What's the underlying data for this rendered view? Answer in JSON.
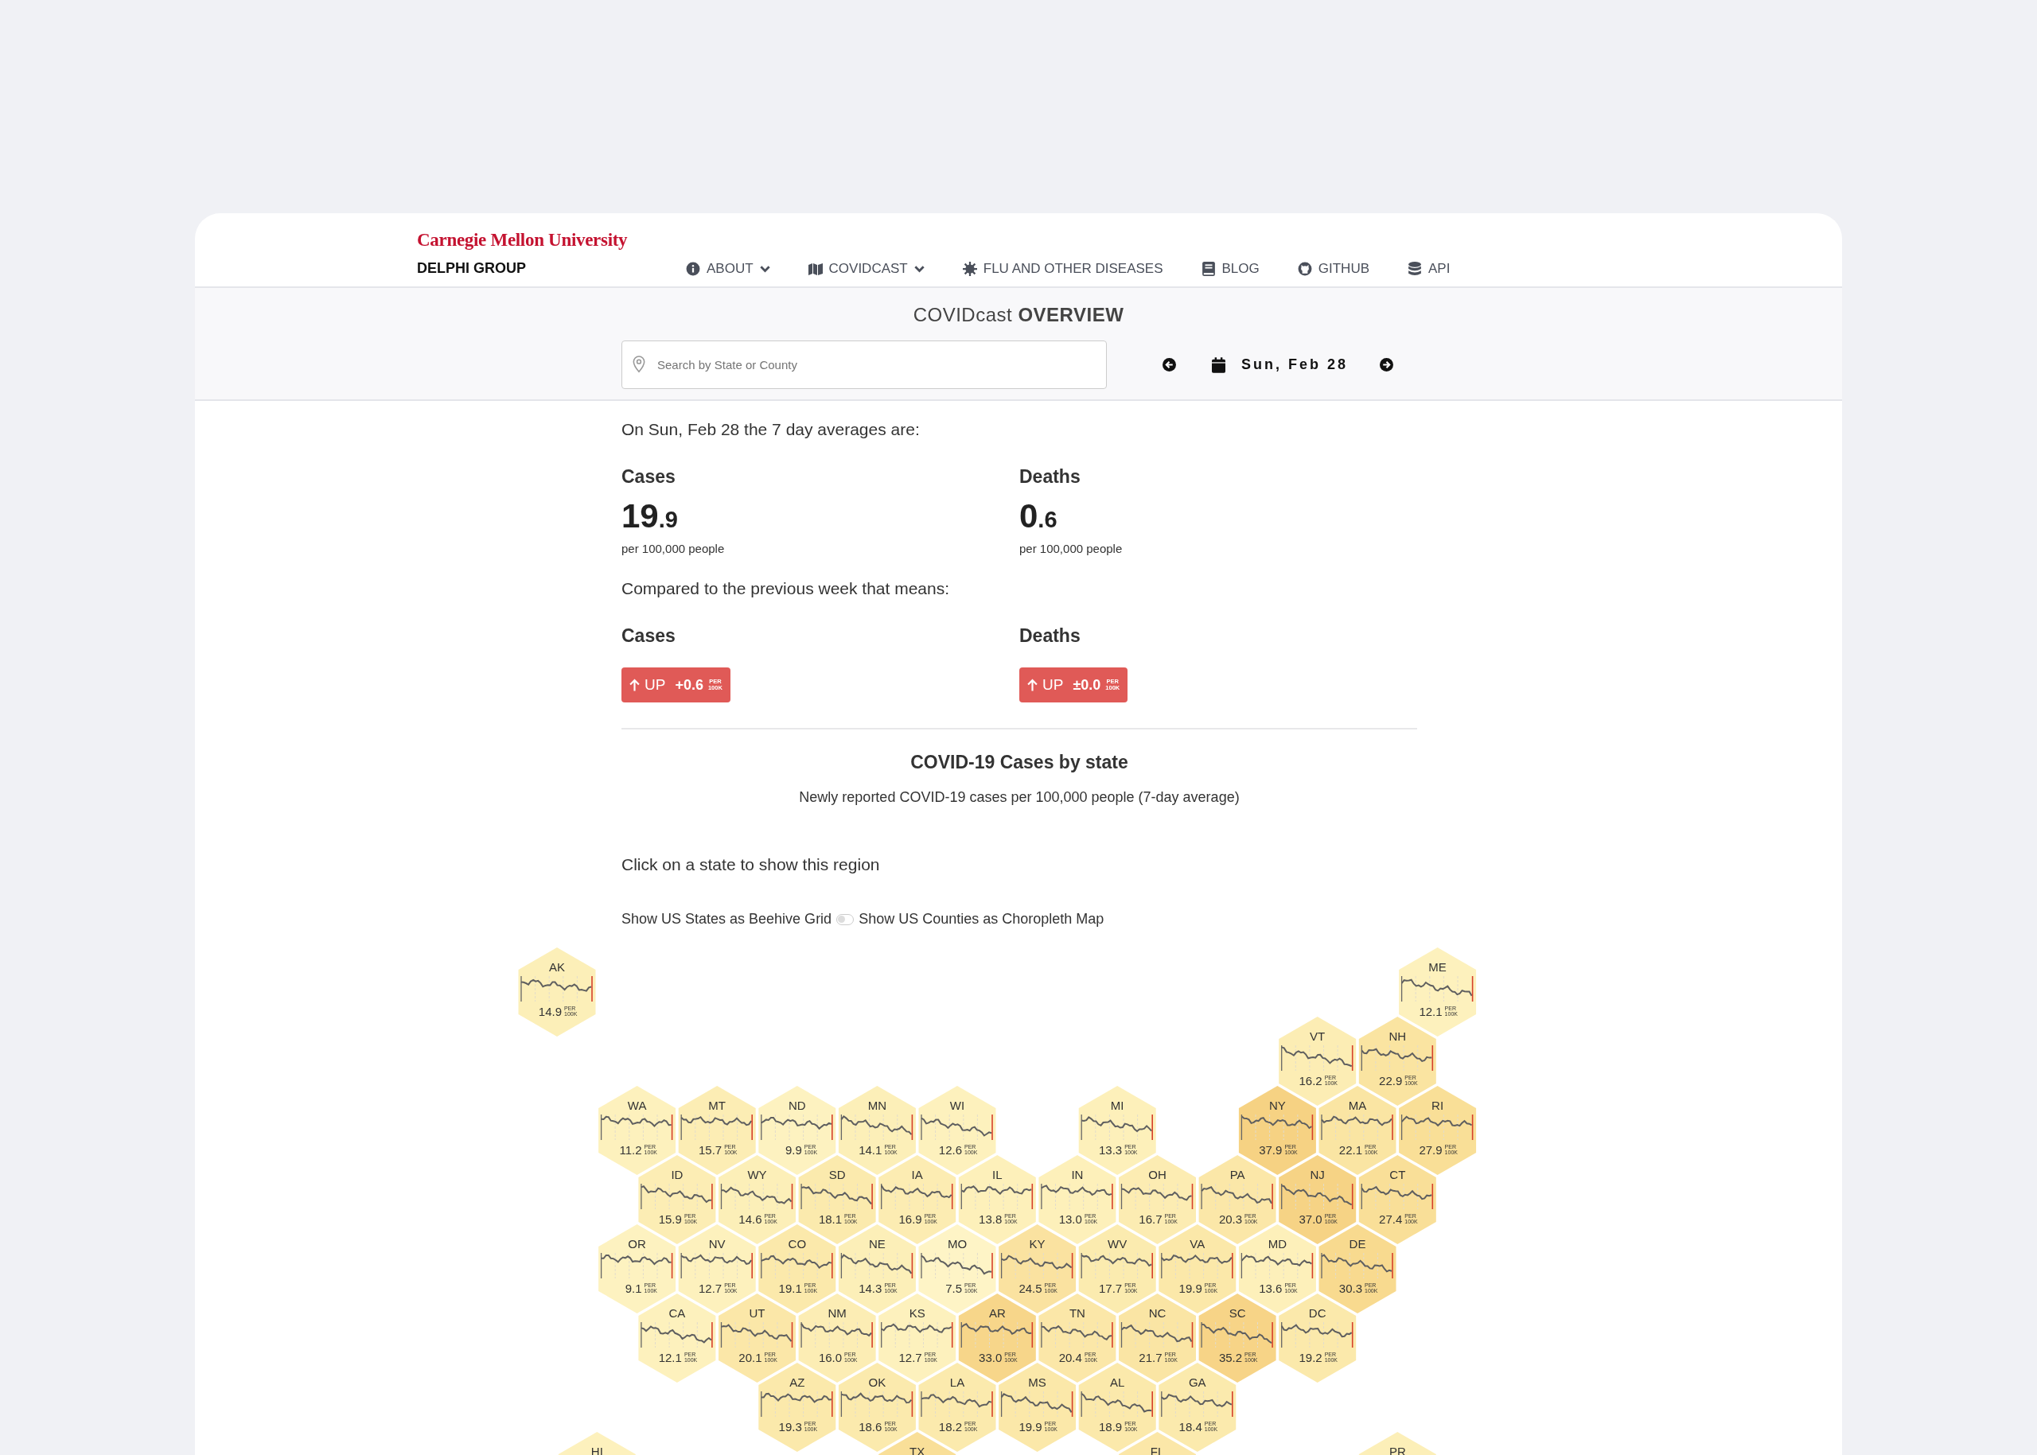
{
  "brand": {
    "university": "Carnegie Mellon University",
    "group": "DELPHI GROUP"
  },
  "nav": [
    {
      "kind": "info",
      "label": "ABOUT",
      "has_menu": true
    },
    {
      "kind": "map",
      "label": "COVIDCAST",
      "has_menu": true
    },
    {
      "kind": "virus",
      "label": "FLU AND OTHER DISEASES",
      "has_menu": false
    },
    {
      "kind": "book",
      "label": "BLOG",
      "has_menu": false
    },
    {
      "kind": "github",
      "label": "GITHUB",
      "has_menu": false
    },
    {
      "kind": "database",
      "label": "API",
      "has_menu": false
    }
  ],
  "page_title": "COVIDcast **OVERVIEW**",
  "search": {
    "placeholder": "Search by State or County"
  },
  "date": "Sun, Feb 28",
  "intro": "On Sun, Feb 28 the 7 day averages are:",
  "averages": [
    {
      "title": "Cases",
      "value_int": "19",
      "value_frac": ".9",
      "unit": "per 100,000 people"
    },
    {
      "title": "Deaths",
      "value_int": "0",
      "value_frac": ".6",
      "unit": "per 100,000 people"
    }
  ],
  "compare_intro": "Compared to the previous week that means:",
  "changes": [
    {
      "title": "Cases",
      "direction": "UP",
      "delta": "+0.6",
      "per": "PER",
      "k": "100K"
    },
    {
      "title": "Deaths",
      "direction": "UP",
      "delta": "±0.0",
      "per": "PER",
      "k": "100K"
    }
  ],
  "map_title": "COVID-19 Cases by state",
  "map_subtitle": "Newly reported COVID-19 cases per 100,000 people (7-day average)",
  "hint": "Click on a state to show this region",
  "toggle": {
    "left": "Show US States as Beehive Grid",
    "right": "Show US Counties as Choropleth Map",
    "on": false
  },
  "hex_rows": [
    [
      {
        "state": "AK",
        "value": "14.9",
        "per": "PER",
        "k": "100K",
        "color": "#fcefb8"
      },
      null,
      null,
      null,
      null,
      null,
      null,
      null,
      null,
      null,
      null,
      {
        "state": "ME",
        "value": "12.1",
        "per": "PER",
        "k": "100K",
        "color": "#fdf1bd"
      }
    ],
    [
      null,
      null,
      null,
      null,
      null,
      null,
      null,
      null,
      null,
      {
        "state": "VT",
        "value": "16.2",
        "per": "PER",
        "k": "100K",
        "color": "#fcedb4"
      },
      {
        "state": "NH",
        "value": "22.9",
        "per": "PER",
        "k": "100K",
        "color": "#fae4a1"
      }
    ],
    [
      null,
      {
        "state": "WA",
        "value": "11.2",
        "per": "PER",
        "k": "100K",
        "color": "#fdf1bd"
      },
      {
        "state": "MT",
        "value": "15.7",
        "per": "PER",
        "k": "100K",
        "color": "#fcedb4"
      },
      {
        "state": "ND",
        "value": "9.9",
        "per": "PER",
        "k": "100K",
        "color": "#fdf2c0"
      },
      {
        "state": "MN",
        "value": "14.1",
        "per": "PER",
        "k": "100K",
        "color": "#fcefb8"
      },
      {
        "state": "WI",
        "value": "12.6",
        "per": "PER",
        "k": "100K",
        "color": "#fdf1bd"
      },
      null,
      {
        "state": "MI",
        "value": "13.3",
        "per": "PER",
        "k": "100K",
        "color": "#fdf0ba"
      },
      null,
      {
        "state": "NY",
        "value": "37.9",
        "per": "PER",
        "k": "100K",
        "color": "#f6d283"
      },
      {
        "state": "MA",
        "value": "22.1",
        "per": "PER",
        "k": "100K",
        "color": "#fae5a3"
      },
      {
        "state": "RI",
        "value": "27.9",
        "per": "PER",
        "k": "100K",
        "color": "#f9df97"
      }
    ],
    [
      null,
      {
        "state": "ID",
        "value": "15.9",
        "per": "PER",
        "k": "100K",
        "color": "#fcedb4"
      },
      {
        "state": "WY",
        "value": "14.6",
        "per": "PER",
        "k": "100K",
        "color": "#fcefb8"
      },
      {
        "state": "SD",
        "value": "18.1",
        "per": "PER",
        "k": "100K",
        "color": "#fbeaad"
      },
      {
        "state": "IA",
        "value": "16.9",
        "per": "PER",
        "k": "100K",
        "color": "#fcecb2"
      },
      {
        "state": "IL",
        "value": "13.8",
        "per": "PER",
        "k": "100K",
        "color": "#fdf0ba"
      },
      {
        "state": "IN",
        "value": "13.0",
        "per": "PER",
        "k": "100K",
        "color": "#fdf0ba"
      },
      {
        "state": "OH",
        "value": "16.7",
        "per": "PER",
        "k": "100K",
        "color": "#fcecb2"
      },
      {
        "state": "PA",
        "value": "20.3",
        "per": "PER",
        "k": "100K",
        "color": "#fbe7a8"
      },
      {
        "state": "NJ",
        "value": "37.0",
        "per": "PER",
        "k": "100K",
        "color": "#f6d385"
      },
      {
        "state": "CT",
        "value": "27.4",
        "per": "PER",
        "k": "100K",
        "color": "#f9df98"
      }
    ],
    [
      null,
      {
        "state": "OR",
        "value": "9.1",
        "per": "PER",
        "k": "100K",
        "color": "#fdf2c0"
      },
      {
        "state": "NV",
        "value": "12.7",
        "per": "PER",
        "k": "100K",
        "color": "#fdf1bd"
      },
      {
        "state": "CO",
        "value": "19.1",
        "per": "PER",
        "k": "100K",
        "color": "#fbe9ab"
      },
      {
        "state": "NE",
        "value": "14.3",
        "per": "PER",
        "k": "100K",
        "color": "#fcefb8"
      },
      {
        "state": "MO",
        "value": "7.5",
        "per": "PER",
        "k": "100K",
        "color": "#fef4c6"
      },
      {
        "state": "KY",
        "value": "24.5",
        "per": "PER",
        "k": "100K",
        "color": "#fae2a0"
      },
      {
        "state": "WV",
        "value": "17.7",
        "per": "PER",
        "k": "100K",
        "color": "#fbebaf"
      },
      {
        "state": "VA",
        "value": "19.9",
        "per": "PER",
        "k": "100K",
        "color": "#fbe8a9"
      },
      {
        "state": "MD",
        "value": "13.6",
        "per": "PER",
        "k": "100K",
        "color": "#fdf0ba"
      },
      {
        "state": "DE",
        "value": "30.3",
        "per": "PER",
        "k": "100K",
        "color": "#f8da8f"
      }
    ],
    [
      null,
      {
        "state": "CA",
        "value": "12.1",
        "per": "PER",
        "k": "100K",
        "color": "#fdf1bd"
      },
      {
        "state": "UT",
        "value": "20.1",
        "per": "PER",
        "k": "100K",
        "color": "#fbe7a8"
      },
      {
        "state": "NM",
        "value": "16.0",
        "per": "PER",
        "k": "100K",
        "color": "#fcedb4"
      },
      {
        "state": "KS",
        "value": "12.7",
        "per": "PER",
        "k": "100K",
        "color": "#fdf1bd"
      },
      {
        "state": "AR",
        "value": "33.0",
        "per": "PER",
        "k": "100K",
        "color": "#f7d68a"
      },
      {
        "state": "TN",
        "value": "20.4",
        "per": "PER",
        "k": "100K",
        "color": "#fbe7a8"
      },
      {
        "state": "NC",
        "value": "21.7",
        "per": "PER",
        "k": "100K",
        "color": "#fae5a4"
      },
      {
        "state": "SC",
        "value": "35.2",
        "per": "PER",
        "k": "100K",
        "color": "#f7d487"
      },
      {
        "state": "DC",
        "value": "19.2",
        "per": "PER",
        "k": "100K",
        "color": "#fbe9ab"
      }
    ],
    [
      null,
      null,
      null,
      {
        "state": "AZ",
        "value": "19.3",
        "per": "PER",
        "k": "100K",
        "color": "#fbe9ab"
      },
      {
        "state": "OK",
        "value": "18.6",
        "per": "PER",
        "k": "100K",
        "color": "#fbeaad"
      },
      {
        "state": "LA",
        "value": "18.2",
        "per": "PER",
        "k": "100K",
        "color": "#fbeaad"
      },
      {
        "state": "MS",
        "value": "19.9",
        "per": "PER",
        "k": "100K",
        "color": "#fbe8a9"
      },
      {
        "state": "AL",
        "value": "18.9",
        "per": "PER",
        "k": "100K",
        "color": "#fbe9ab"
      },
      {
        "state": "GA",
        "value": "18.4",
        "per": "PER",
        "k": "100K",
        "color": "#fbeaad"
      }
    ],
    [
      {
        "state": "HI",
        "color": "#fdf1bd"
      },
      null,
      null,
      null,
      {
        "state": "TX",
        "color": "#f9df98"
      },
      null,
      null,
      {
        "state": "FL",
        "color": "#fbe7a8"
      },
      null,
      null,
      {
        "state": "PR",
        "color": "#fcefb8"
      }
    ]
  ]
}
